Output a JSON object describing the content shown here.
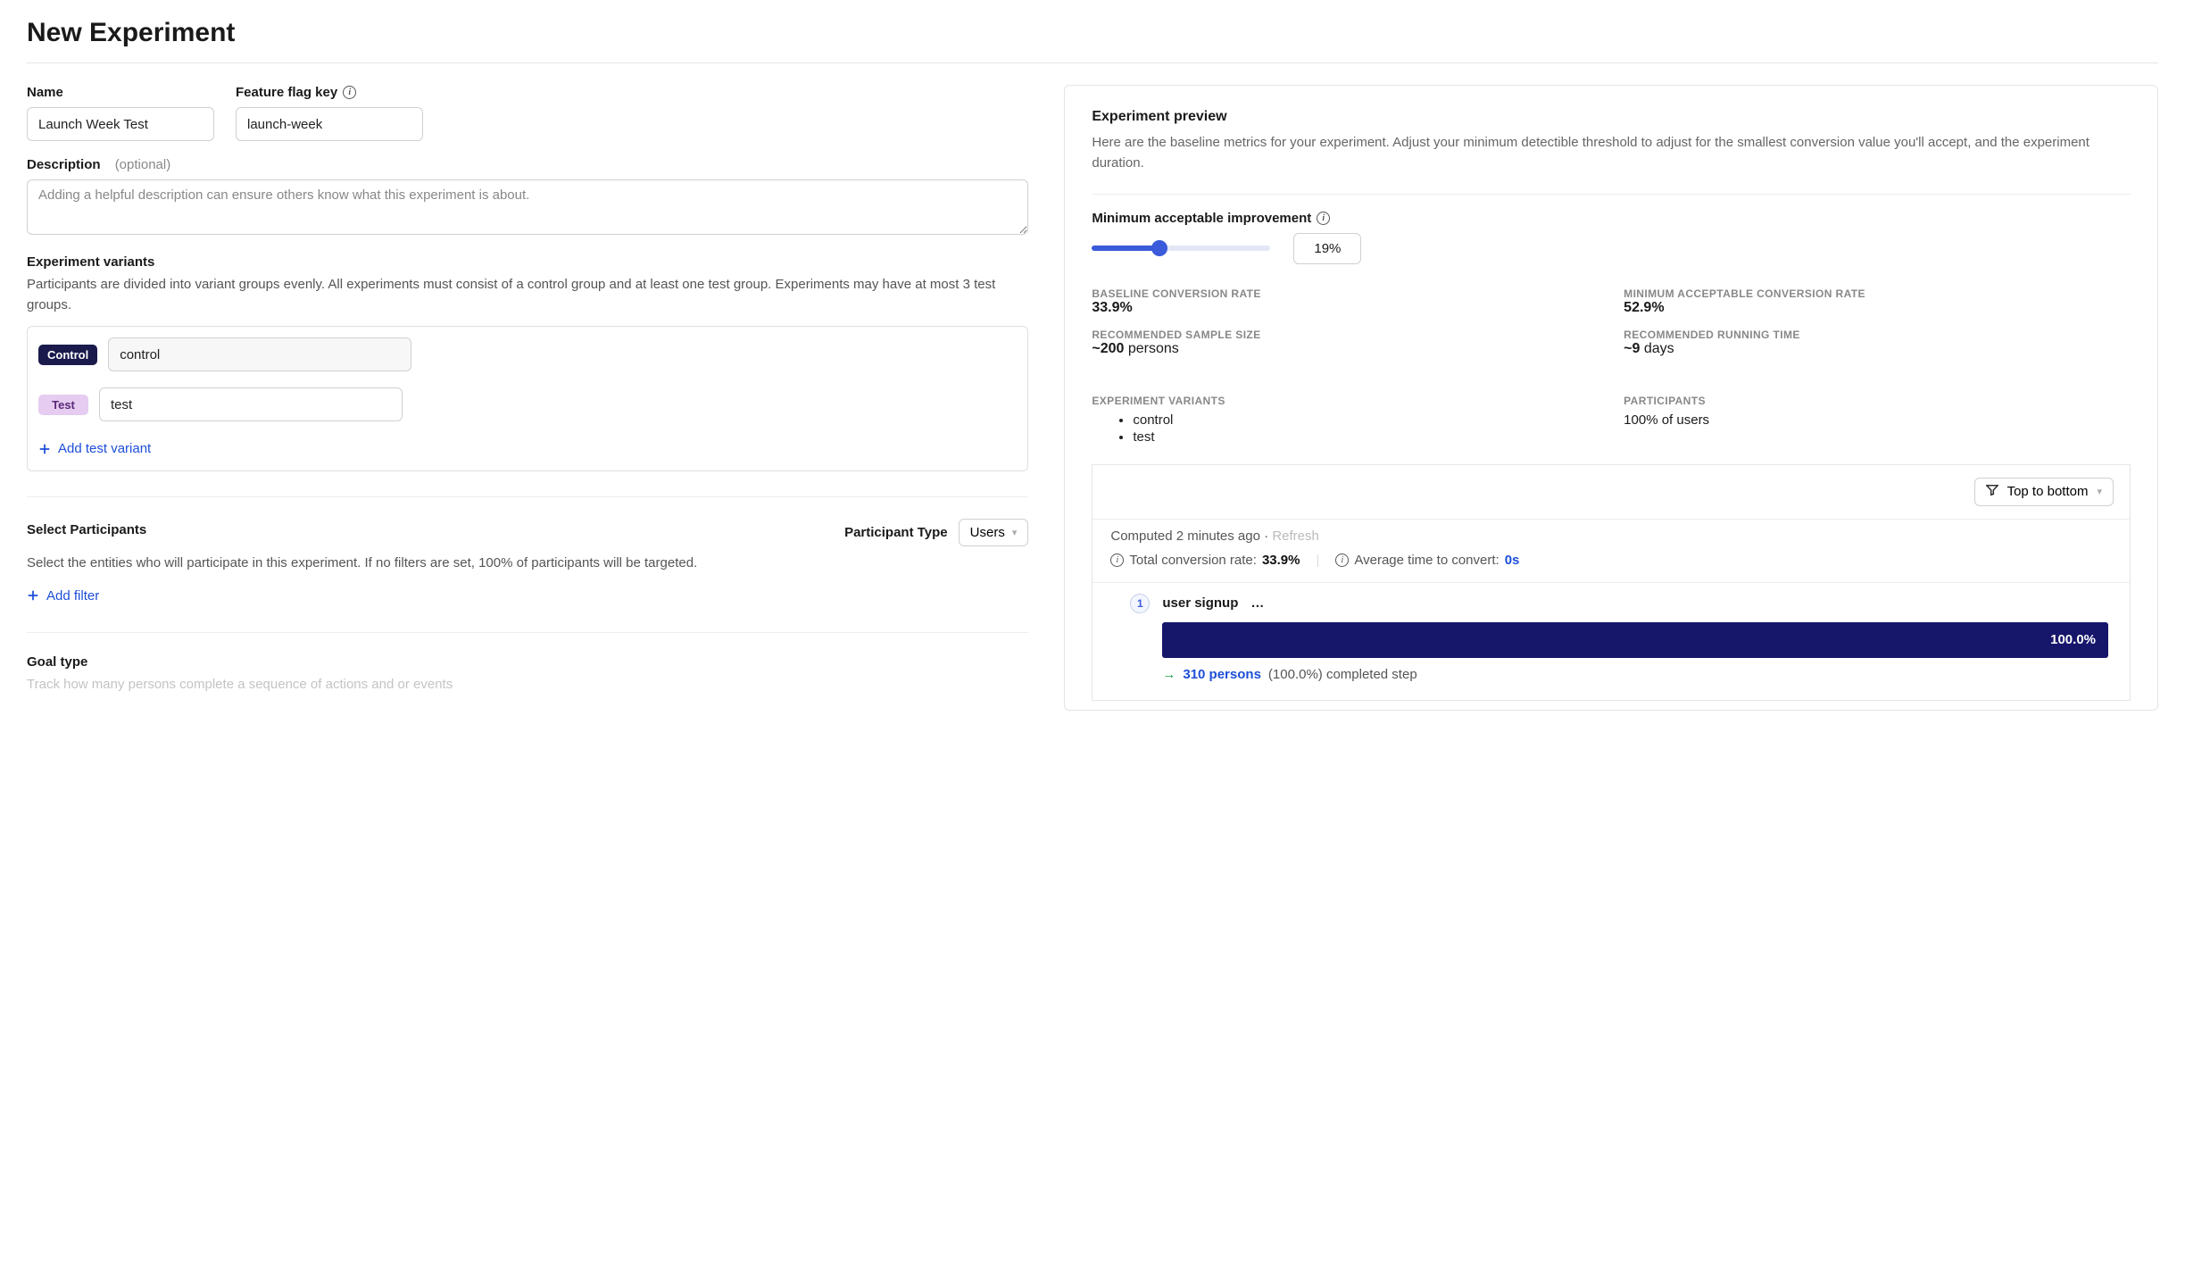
{
  "page_title": "New Experiment",
  "left": {
    "name_label": "Name",
    "name_value": "Launch Week Test",
    "flag_label": "Feature flag key",
    "flag_value": "launch-week",
    "desc_label": "Description",
    "desc_optional": "(optional)",
    "desc_placeholder": "Adding a helpful description can ensure others know what this experiment is about.",
    "variants_label": "Experiment variants",
    "variants_help": "Participants are divided into variant groups evenly. All experiments must consist of a control group and at least one test group. Experiments may have at most 3 test groups.",
    "control_badge": "Control",
    "control_value": "control",
    "test_badge": "Test",
    "test_value": "test",
    "add_variant": "Add test variant",
    "participants_label": "Select Participants",
    "participant_type_label": "Participant Type",
    "participant_type_value": "Users",
    "participants_help": "Select the entities who will participate in this experiment. If no filters are set, 100% of participants will be targeted.",
    "add_filter": "Add filter",
    "goal_label": "Goal type",
    "goal_help": "Track how many persons complete a sequence of actions and or events"
  },
  "right": {
    "preview_title": "Experiment preview",
    "preview_desc": "Here are the baseline metrics for your experiment. Adjust your minimum detectible threshold to adjust for the smallest conversion value you'll accept, and the experiment duration.",
    "min_improve_label": "Minimum acceptable improvement",
    "min_improve_value": "19%",
    "metrics": {
      "baseline_label": "BASELINE CONVERSION RATE",
      "baseline_value": "33.9%",
      "min_conv_label": "MINIMUM ACCEPTABLE CONVERSION RATE",
      "min_conv_value": "52.9%",
      "sample_label": "RECOMMENDED SAMPLE SIZE",
      "sample_value": "~200 persons",
      "time_label": "RECOMMENDED RUNNING TIME",
      "time_value": "~9 days"
    },
    "variants_label": "EXPERIMENT VARIANTS",
    "variants_list": [
      "control",
      "test"
    ],
    "participants_label": "PARTICIPANTS",
    "participants_value": "100% of users",
    "funnel": {
      "orientation": "Top to bottom",
      "computed": "Computed 2 minutes ago",
      "dot": "·",
      "refresh": "Refresh",
      "total_label": "Total conversion rate:",
      "total_value": "33.9%",
      "avg_label": "Average time to convert:",
      "avg_value": "0s",
      "step_num": "1",
      "step_name": "user signup",
      "bar_value": "100.0%",
      "persons": "310 persons",
      "completed": "(100.0%) completed step"
    }
  }
}
